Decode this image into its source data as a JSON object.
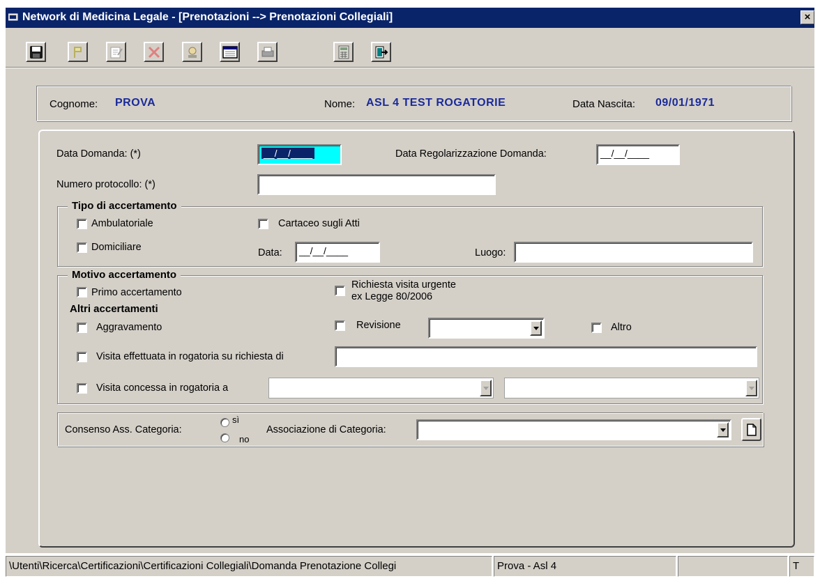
{
  "window": {
    "title": "Network di Medicina Legale - [Prenotazioni --> Prenotazioni Collegiali]",
    "close_label": "×"
  },
  "toolbar": {
    "buttons": [
      {
        "name": "save-icon"
      },
      {
        "name": "flag-icon"
      },
      {
        "name": "edit-icon"
      },
      {
        "name": "delete-icon"
      },
      {
        "name": "person-icon"
      },
      {
        "name": "calendar-icon"
      },
      {
        "name": "print-icon"
      },
      {
        "name": "calculator-icon"
      },
      {
        "name": "exit-icon"
      }
    ]
  },
  "patient": {
    "surname_label": "Cognome:",
    "surname": "PROVA",
    "name_label": "Nome:",
    "name": "ASL 4  TEST ROGATORIE",
    "birth_label": "Data Nascita:",
    "birth": "09/01/1971"
  },
  "form": {
    "data_domanda_label": "Data Domanda: (*)",
    "data_domanda_value": "__/__/____",
    "data_regolarizzazione_label": "Data Regolarizzazione Domanda:",
    "data_regolarizzazione_value": "__/__/____",
    "numero_protocollo_label": "Numero protocollo: (*)",
    "numero_protocollo_value": ""
  },
  "tipo": {
    "title": "Tipo di accertamento",
    "ambulatoriale": "Ambulatoriale",
    "cartaceo": "Cartaceo sugli Atti",
    "domiciliare": "Domiciliare",
    "data_label": "Data:",
    "data_value": "__/__/____",
    "luogo_label": "Luogo:",
    "luogo_value": ""
  },
  "motivo": {
    "title": "Motivo accertamento",
    "primo": "Primo accertamento",
    "urgente_line1": "Richiesta visita urgente",
    "urgente_line2": "ex Legge 80/2006",
    "altri_title": "Altri accertamenti",
    "aggravamento": "Aggravamento",
    "revisione": "Revisione",
    "altro": "Altro",
    "rogatoria_richiesta": "Visita effettuata in rogatoria su richiesta di",
    "rogatoria_concessa": "Visita concessa in rogatoria a"
  },
  "consenso": {
    "label": "Consenso Ass. Categoria:",
    "si": "sì",
    "no": "no",
    "associazione_label": "Associazione di Categoria:"
  },
  "statusbar": {
    "path": "\\Utenti\\Ricerca\\Certificazioni\\Certificazioni Collegiali\\Domanda Prenotazione Collegi",
    "user": "Prova - Asl 4",
    "empty": "",
    "last": "T"
  }
}
